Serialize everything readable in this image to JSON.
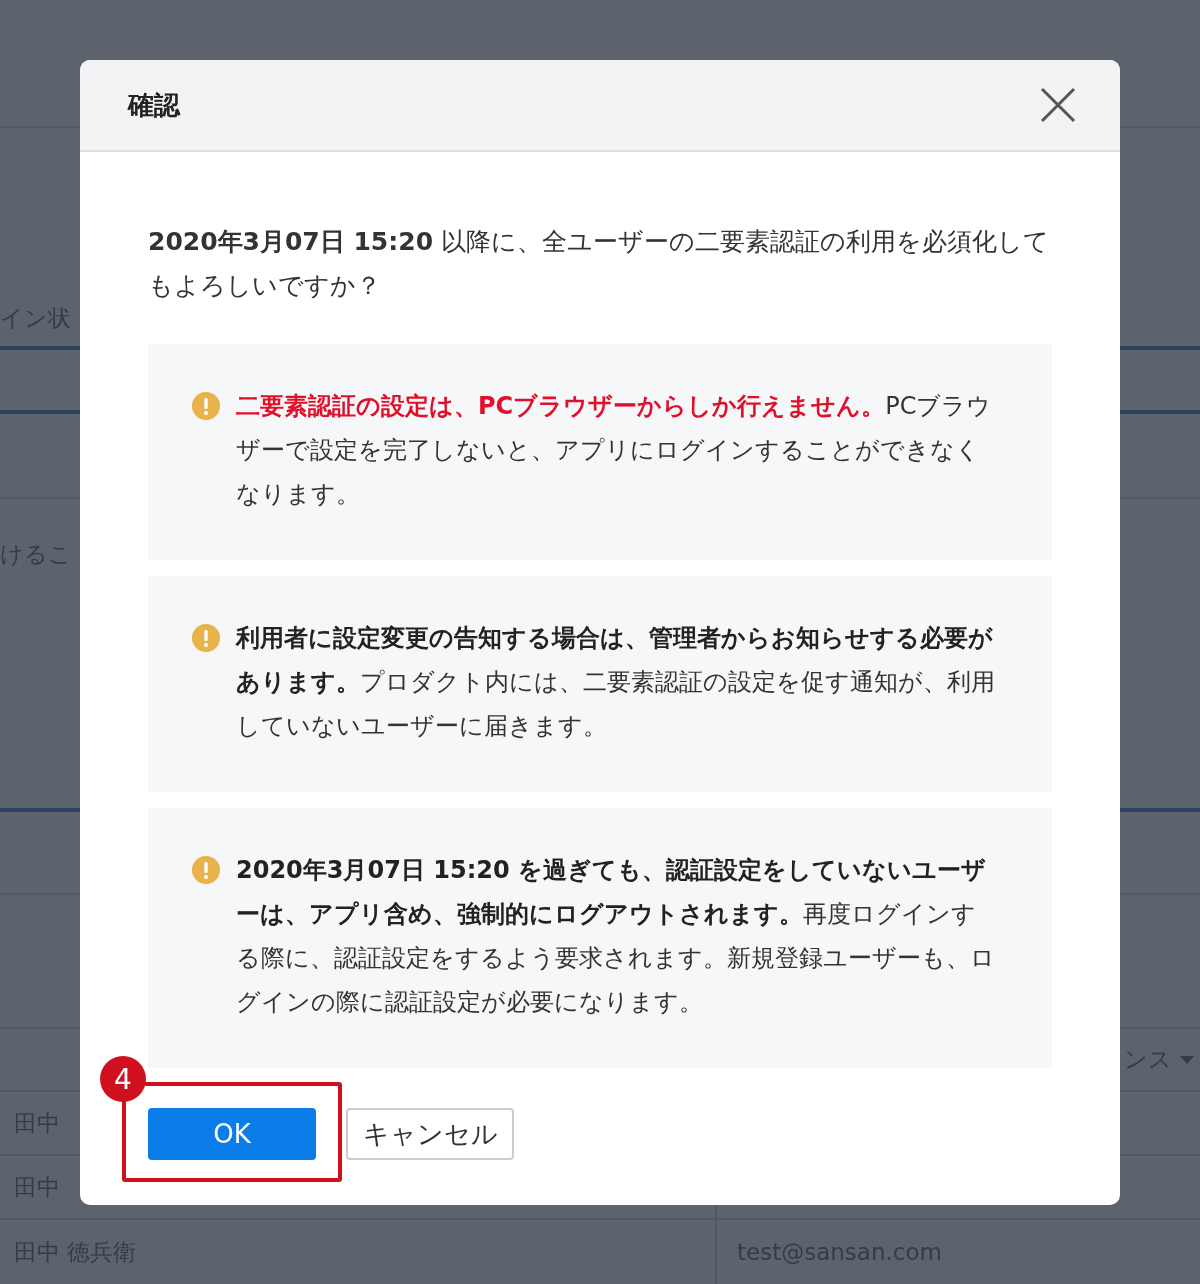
{
  "background_page": {
    "status_label": "イン状",
    "description": "けるこ",
    "dropdown": {
      "value": "ンス"
    },
    "table_rows": [
      {
        "name": "田中"
      },
      {
        "name": "田中"
      },
      {
        "name": "田中 徳兵衛",
        "email": "test@sansan.com"
      }
    ]
  },
  "dialog": {
    "title": "確認",
    "message": "**2020年3月07日 15:20** 以降に、全ユーザーの二要素認証の利用を必須化してもよろしいですか？",
    "notices": [
      {
        "headline": "二要素認証の設定は、PCブラウザーからしか行えません。",
        "alert": true,
        "body": "PCブラウザーで設定を完了しないと、アプリにログインすることができなくなります。"
      },
      {
        "headline": "利用者に設定変更の告知する場合は、管理者からお知らせする必要があります。",
        "alert": false,
        "body": "プロダクト内には、二要素認証の設定を促す通知が、利用していないユーザーに届きます。"
      },
      {
        "headline": "2020年3月07日 15:20 を過ぎても、認証設定をしていないユーザーは、アプリ含め、強制的にログアウトされます。",
        "alert": false,
        "body": "再度ログインする際に、認証設定をするよう要求されます。新規登録ユーザーも、ログインの際に認証設定が必要になります。"
      }
    ],
    "buttons": [
      {
        "label": "OK",
        "kind": "primary"
      },
      {
        "label": "キャンセル",
        "kind": "secondary"
      }
    ],
    "annotation": {
      "number": "4"
    }
  }
}
